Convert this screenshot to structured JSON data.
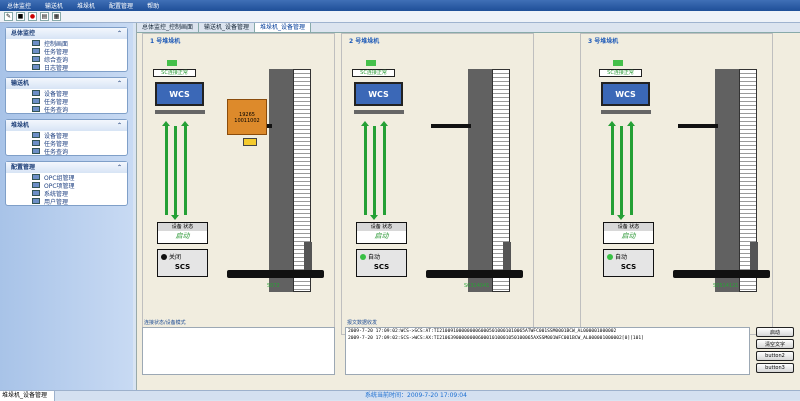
{
  "menu": [
    "总体监控",
    "输送机",
    "堆垛机",
    "配置管理",
    "帮助"
  ],
  "toolbar_icons": [
    "pencil-icon",
    "save-icon",
    "close-icon",
    "print-icon",
    "table-icon"
  ],
  "sidebar": [
    {
      "title": "总体监控",
      "items": [
        "控制画面",
        "任务管理",
        "综合查询",
        "日志管理"
      ]
    },
    {
      "title": "输送机",
      "items": [
        "设备管理",
        "任务管理",
        "任务查询"
      ]
    },
    {
      "title": "堆垛机",
      "items": [
        "设备管理",
        "任务管理",
        "任务查询"
      ]
    },
    {
      "title": "配置管理",
      "items": [
        "OPC组管理",
        "OPC项管理",
        "系统管理",
        "用户管理"
      ]
    }
  ],
  "tabs": [
    "总体监控_控制画面",
    "输送机_设备管理",
    "堆垛机_设备管理"
  ],
  "stackers": [
    {
      "title": "1 号堆垛机",
      "status": "SC连接正常",
      "pc": "WCS",
      "panel_top": "设备 状态",
      "panel_bottom": "启动",
      "scs_mode": "关闭",
      "scs_label": "SCS",
      "code": "S072",
      "cargo_top": "19265",
      "cargo_bottom": "10011002"
    },
    {
      "title": "2 号堆垛机",
      "status": "SC连接正常",
      "pc": "WCS",
      "panel_top": "设备 状态",
      "panel_bottom": "启动",
      "scs_mode": "自动",
      "scs_label": "SCS",
      "code": "S0314041"
    },
    {
      "title": "3 号堆垛机",
      "status": "SC连接正常",
      "pc": "WCS",
      "panel_top": "设备 状态",
      "panel_bottom": "启动",
      "scs_mode": "自动",
      "scs_label": "SCS",
      "code": "S0514121"
    }
  ],
  "left_box_title": "连接状态/设备模式",
  "right_box_title": "报文数据收发",
  "logs": [
    "2009-7-20 17:09:02:WCS->SCS:AT:TI2100910000000060005010001010065ATWFC001SSM0001BCW_AL000001000002",
    "2009-7-20 17:09:02:SCS->WCS:AX:TI2106390000000060001010001050100065AXSSM001WFC001BCW_AL000001000002[0][101]"
  ],
  "buttons": [
    "启动",
    "清空文字",
    "button2",
    "button3"
  ],
  "status_left": "堆垛机_设备管理",
  "status_center": "系统当前时间：2009-7-20 17:09:04"
}
